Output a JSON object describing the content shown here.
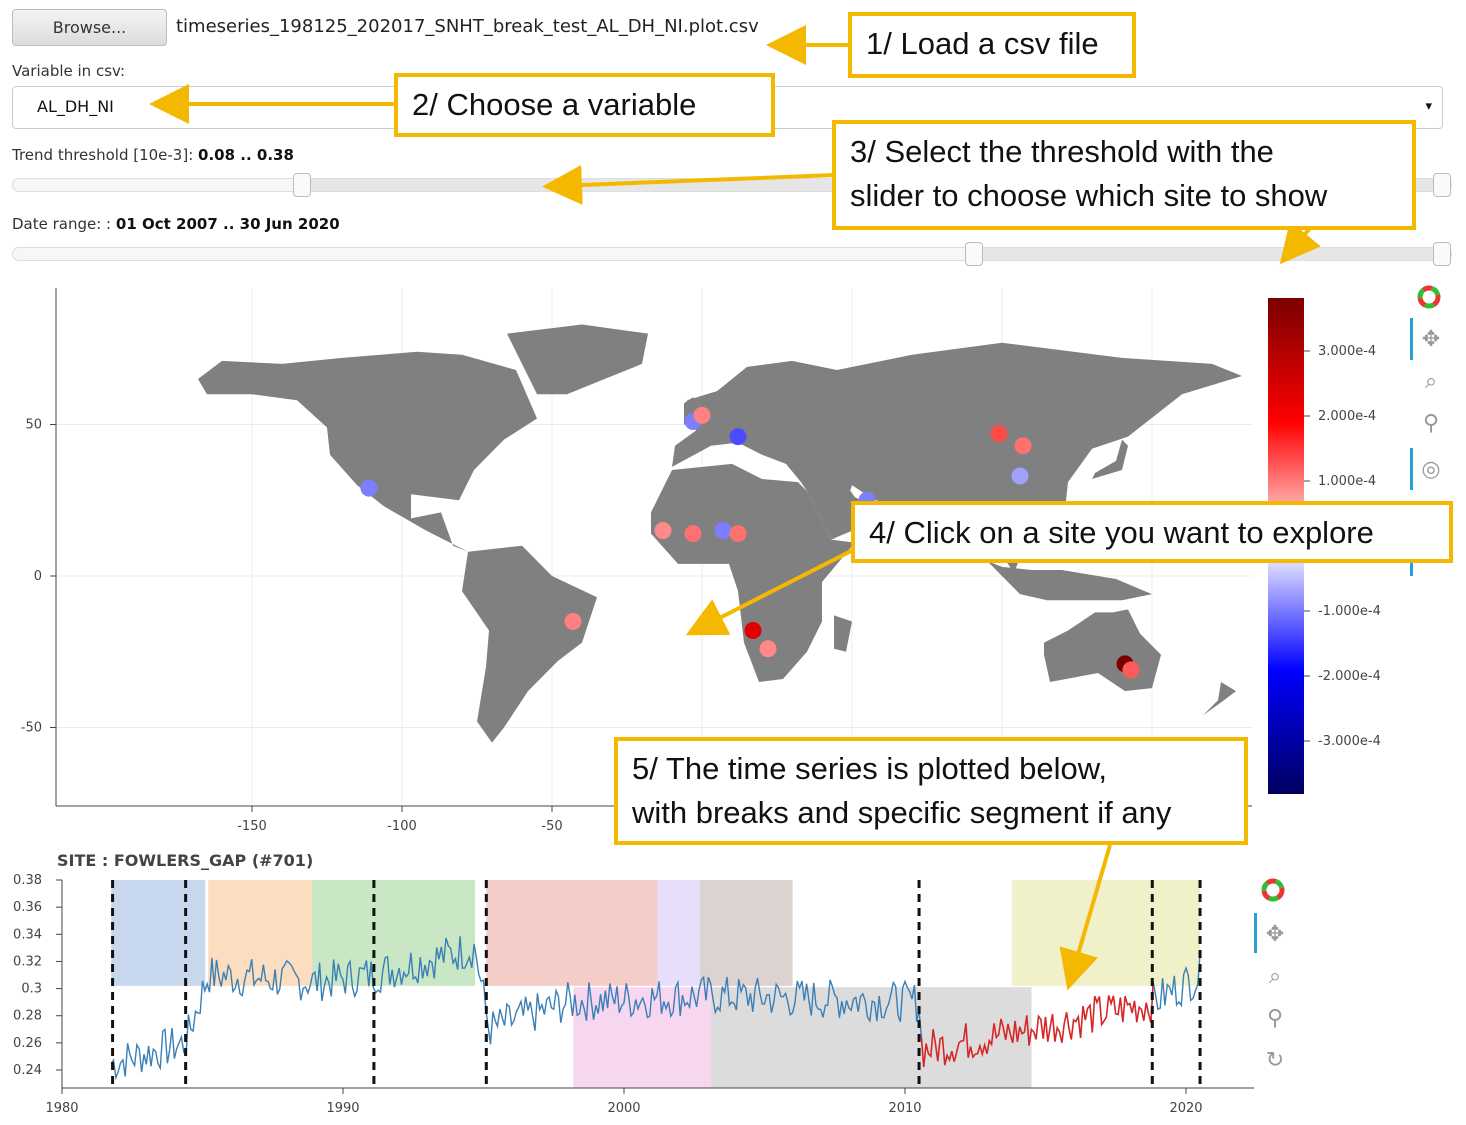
{
  "file_loader": {
    "browse_label": "Browse...",
    "file_name": "timeseries_198125_202017_SNHT_break_test_AL_DH_NI.plot.csv"
  },
  "variable": {
    "label": "Variable in csv:",
    "value": "AL_DH_NI",
    "caret": "▾"
  },
  "trend": {
    "label": "Trend threshold [10e-3]:",
    "value": "0.08 .. 0.38"
  },
  "date_range": {
    "label": "Date range: :",
    "value": "01 Oct 2007 .. 30 Jun 2020"
  },
  "callouts": {
    "c1": "1/ Load a csv file",
    "c2": "2/ Choose a variable",
    "c3a": "3/ Select the threshold with the",
    "c3b": "slider to choose which site to show",
    "c4": "4/ Click on a site you want to explore",
    "c5a": "5/ The time series is plotted below,",
    "c5b": "with breaks and specific segment if any"
  },
  "map": {
    "y_ticks": [
      "50",
      "0",
      "-50"
    ],
    "x_ticks": [
      "-150",
      "-100",
      "-50"
    ],
    "colorbar_ticks": [
      "3.000e-4",
      "2.000e-4",
      "1.000e-4",
      "-1.000e-4",
      "-2.000e-4",
      "-3.000e-4"
    ],
    "land_color": "#808080",
    "sites": [
      {
        "lon": -111,
        "lat": 29,
        "color": "#7d7dff"
      },
      {
        "lon": -3,
        "lat": 51,
        "color": "#7d7dff"
      },
      {
        "lon": 0,
        "lat": 53,
        "color": "#ff8080"
      },
      {
        "lon": 12,
        "lat": 46,
        "color": "#4b4bff"
      },
      {
        "lon": -13,
        "lat": 15,
        "color": "#ff8a8a"
      },
      {
        "lon": -3,
        "lat": 14,
        "color": "#ff7070"
      },
      {
        "lon": 7,
        "lat": 15,
        "color": "#7d7dff"
      },
      {
        "lon": 12,
        "lat": 14,
        "color": "#ff7070"
      },
      {
        "lon": -43,
        "lat": -15,
        "color": "#ff8080"
      },
      {
        "lon": 17,
        "lat": -18,
        "color": "#e00000"
      },
      {
        "lon": 22,
        "lat": -24,
        "color": "#ff8a8a"
      },
      {
        "lon": 55,
        "lat": 25,
        "color": "#7d7dff"
      },
      {
        "lon": 99,
        "lat": 47,
        "color": "#ff4a4a"
      },
      {
        "lon": 107,
        "lat": 43,
        "color": "#ff7070"
      },
      {
        "lon": 106,
        "lat": 33,
        "color": "#a0a0ff"
      },
      {
        "lon": 141,
        "lat": -29,
        "color": "#7a0000"
      },
      {
        "lon": 143,
        "lat": -31,
        "color": "#ff5a5a"
      }
    ]
  },
  "timeseries": {
    "title": "SITE : FOWLERS_GAP (#701)",
    "y_ticks": [
      "0.38",
      "0.36",
      "0.34",
      "0.32",
      "0.3",
      "0.28",
      "0.26",
      "0.24"
    ],
    "x_ticks": [
      "1980",
      "1990",
      "2000",
      "2010",
      "2020"
    ],
    "breaks": [
      1981.8,
      1984.4,
      1991.1,
      1995.1,
      2010.5,
      2018.8,
      2020.5
    ],
    "segments": [
      {
        "from": 1981.75,
        "to": 1985.1,
        "color": "#c7d8ee",
        "band": "top"
      },
      {
        "from": 1985.2,
        "to": 1988.9,
        "color": "#fdddc0",
        "band": "top"
      },
      {
        "from": 1988.9,
        "to": 1994.7,
        "color": "#c9e6c5",
        "band": "top"
      },
      {
        "from": 1995.1,
        "to": 2001.2,
        "color": "#f5cdc8",
        "band": "top"
      },
      {
        "from": 2001.2,
        "to": 2002.7,
        "color": "#e6defa",
        "band": "top"
      },
      {
        "from": 2002.7,
        "to": 2006.0,
        "color": "#dcd2d0",
        "band": "top"
      },
      {
        "from": 2013.8,
        "to": 2020.5,
        "color": "#f0f0c9",
        "band": "top"
      },
      {
        "from": 1998.2,
        "to": 2003.1,
        "color": "#f7d7f0",
        "band": "bottom"
      },
      {
        "from": 2003.1,
        "to": 2014.5,
        "color": "#dcdcdc",
        "band": "bottom"
      }
    ],
    "series_colors": {
      "normal": "#3a7fb6",
      "highlight": "#d62728"
    },
    "highlight_range": [
      2010.5,
      2018.8
    ]
  }
}
